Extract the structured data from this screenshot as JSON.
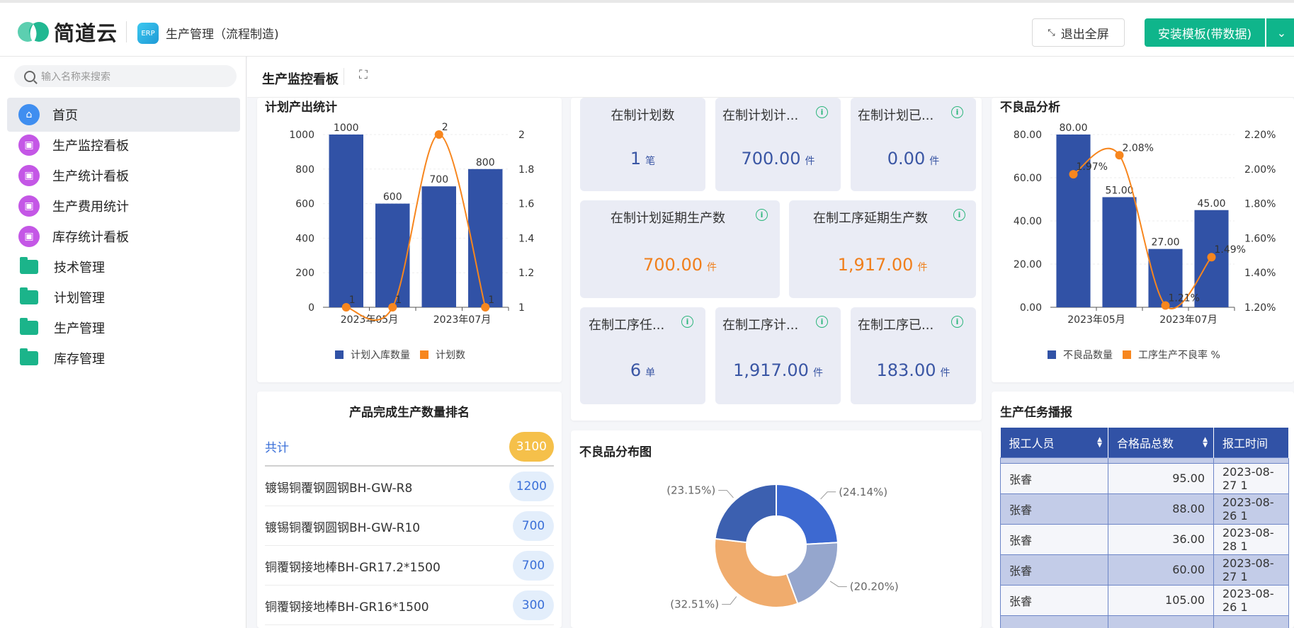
{
  "header": {
    "brand": "简道云",
    "app_icon": "ERP",
    "app_title": "生产管理（流程制造)",
    "exit_fullscreen": "退出全屏",
    "install_button": "安装模板(带数据)"
  },
  "sidebar": {
    "search_placeholder": "输入名称来搜索",
    "items": [
      {
        "label": "首页",
        "icon": "home-icon"
      },
      {
        "label": "生产监控看板",
        "icon": "dashboard-icon"
      },
      {
        "label": "生产统计看板",
        "icon": "dashboard-icon"
      },
      {
        "label": "生产费用统计",
        "icon": "dashboard-icon"
      },
      {
        "label": "库存统计看板",
        "icon": "dashboard-icon"
      },
      {
        "label": "技术管理",
        "icon": "folder-icon"
      },
      {
        "label": "计划管理",
        "icon": "folder-icon"
      },
      {
        "label": "生产管理",
        "icon": "folder-icon"
      },
      {
        "label": "库存管理",
        "icon": "folder-icon"
      }
    ]
  },
  "page": {
    "title": "生产监控看板"
  },
  "plan_output": {
    "title": "计划产出统计",
    "legend_bar": "计划入库数量",
    "legend_line": "计划数",
    "x_labels": [
      "2023年05月",
      "2023年07月"
    ]
  },
  "stats": {
    "s1": {
      "label": "在制计划数",
      "value": "1",
      "unit": "笔"
    },
    "s2": {
      "label": "在制计划计...",
      "value": "700.00",
      "unit": "件"
    },
    "s3": {
      "label": "在制计划已...",
      "value": "0.00",
      "unit": "件"
    },
    "s4": {
      "label": "在制计划延期生产数",
      "value": "700.00",
      "unit": "件"
    },
    "s5": {
      "label": "在制工序延期生产数",
      "value": "1,917.00",
      "unit": "件"
    },
    "s6": {
      "label": "在制工序任...",
      "value": "6",
      "unit": "单"
    },
    "s7": {
      "label": "在制工序计...",
      "value": "1,917.00",
      "unit": "件"
    },
    "s8": {
      "label": "在制工序已...",
      "value": "183.00",
      "unit": "件"
    }
  },
  "defect_analysis": {
    "title": "不良品分析",
    "legend_bar": "不良品数量",
    "legend_line": "工序生产不良率 %",
    "x_labels": [
      "2023年05月",
      "2023年07月"
    ]
  },
  "ranking": {
    "title": "产品完成生产数量排名",
    "total_label": "共计",
    "total_value": "3100",
    "rows": [
      {
        "name": "镀锡铜覆钢圆钢BH-GW-R8",
        "value": "1200"
      },
      {
        "name": "镀锡铜覆钢圆钢BH-GW-R10",
        "value": "700"
      },
      {
        "name": "铜覆钢接地棒BH-GR17.2*1500",
        "value": "700"
      },
      {
        "name": "铜覆钢接地棒BH-GR16*1500",
        "value": "300"
      }
    ]
  },
  "defect_distribution": {
    "title": "不良品分布图"
  },
  "tasks": {
    "title": "生产任务播报",
    "headers": [
      "报工人员",
      "合格品总数",
      "报工时间"
    ],
    "rows": [
      {
        "name": "张睿",
        "qty": "95.00",
        "time": "2023-08-27 1"
      },
      {
        "name": "张睿",
        "qty": "88.00",
        "time": "2023-08-26 1"
      },
      {
        "name": "张睿",
        "qty": "36.00",
        "time": "2023-08-28 1"
      },
      {
        "name": "张睿",
        "qty": "60.00",
        "time": "2023-08-27 1"
      },
      {
        "name": "张睿",
        "qty": "105.00",
        "time": "2023-08-26 1"
      }
    ]
  },
  "chart_data": [
    {
      "type": "bar",
      "title": "计划产出统计",
      "categories": [
        "2023年05月",
        "",
        "2023年07月",
        ""
      ],
      "series": [
        {
          "name": "计划入库数量",
          "type": "bar",
          "values": [
            1000,
            600,
            700,
            800
          ],
          "axis": "left",
          "color": "#3152a6"
        },
        {
          "name": "计划数",
          "type": "line",
          "values": [
            1,
            1,
            2,
            1
          ],
          "axis": "right",
          "color": "#f7861e"
        }
      ],
      "ylim": [
        0,
        1000
      ],
      "y_ticks": [
        "0",
        "200",
        "400",
        "600",
        "800",
        "1000"
      ],
      "y2lim": [
        1,
        2
      ],
      "y2_ticks": [
        "1",
        "1.2",
        "1.4",
        "1.6",
        "1.8",
        "2"
      ],
      "legend": "bottom"
    },
    {
      "type": "bar",
      "title": "不良品分析",
      "categories": [
        "2023年05月",
        "",
        "2023年07月",
        ""
      ],
      "series": [
        {
          "name": "不良品数量",
          "type": "bar",
          "values": [
            80,
            51,
            27,
            45
          ],
          "labels": [
            "80.00",
            "51.00",
            "27.00",
            "45.00"
          ],
          "axis": "left",
          "color": "#3152a6"
        },
        {
          "name": "工序生产不良率 %",
          "type": "line",
          "values": [
            1.97,
            2.08,
            1.21,
            1.49
          ],
          "labels": [
            "1.97%",
            "2.08%",
            "1.21%",
            "1.49%"
          ],
          "axis": "right",
          "color": "#f7861e"
        }
      ],
      "ylim": [
        0,
        80
      ],
      "y_ticks": [
        "0.00",
        "20.00",
        "40.00",
        "60.00",
        "80.00"
      ],
      "y2lim": [
        1.2,
        2.2
      ],
      "y2_ticks": [
        "1.20%",
        "1.40%",
        "1.60%",
        "1.80%",
        "2.00%",
        "2.20%"
      ],
      "legend": "bottom"
    },
    {
      "type": "pie",
      "title": "不良品分布图",
      "donut": true,
      "slices": [
        {
          "label": "(24.14%)",
          "value": 24.14,
          "color": "#3d69d1"
        },
        {
          "label": "(20.20%)",
          "value": 20.2,
          "color": "#95a6cd"
        },
        {
          "label": "(32.51%)",
          "value": 32.51,
          "color": "#f0ac6d"
        },
        {
          "label": "(23.15%)",
          "value": 23.15,
          "color": "#3c60b0"
        }
      ]
    }
  ]
}
